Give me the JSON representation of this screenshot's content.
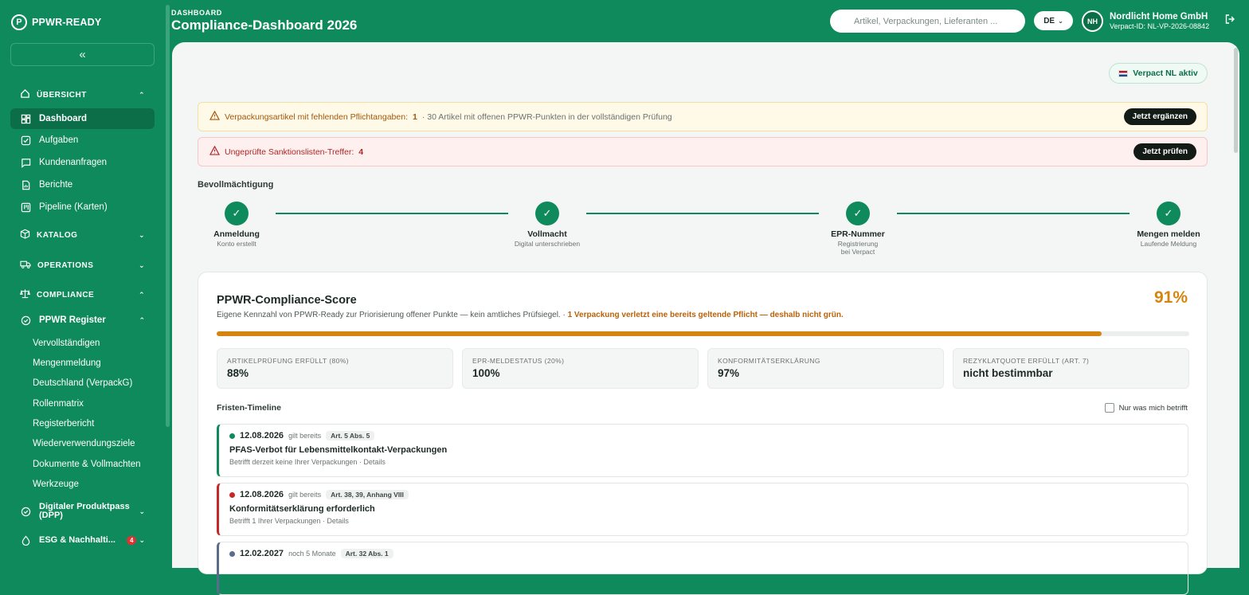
{
  "app": {
    "name": "PPWR-READY",
    "collapse": "«"
  },
  "sidebar": {
    "sections": [
      {
        "label": "ÜBERSICHT",
        "chev": "⌃"
      },
      {
        "label": "KATALOG",
        "chev": "⌄"
      },
      {
        "label": "OPERATIONS",
        "chev": "⌄"
      },
      {
        "label": "COMPLIANCE",
        "chev": "⌃"
      }
    ],
    "items": [
      {
        "label": "Dashboard"
      },
      {
        "label": "Aufgaben"
      },
      {
        "label": "Kundenanfragen"
      },
      {
        "label": "Berichte"
      },
      {
        "label": "Pipeline (Karten)"
      }
    ],
    "register": {
      "label": "PPWR Register",
      "chev": "⌃"
    },
    "subitems": [
      "Vervollständigen",
      "Mengenmeldung",
      "Deutschland (VerpackG)",
      "Rollenmatrix",
      "Registerbericht",
      "Wiederverwendungsziele",
      "Dokumente & Vollmachten",
      "Werkzeuge"
    ],
    "dpp": {
      "label1": "Digitaler Produktpass",
      "label2": "(DPP)",
      "chev": "⌄"
    },
    "esg": {
      "label": "ESG & Nachhalti...",
      "badge": "4",
      "chev": "⌄"
    }
  },
  "header": {
    "crumb": "DASHBOARD",
    "title": "Compliance-Dashboard 2026",
    "search_placeholder": "Artikel, Verpackungen, Lieferanten ...",
    "lang": "DE",
    "avatar": "NH",
    "org_name": "Nordlicht Home GmbH",
    "org_id": "Verpact-ID: NL-VP-2026-08842"
  },
  "verpact_badge": "Verpact NL aktiv",
  "alerts": {
    "warn": {
      "text": "Verpackungsartikel mit fehlenden Pflichtangaben:",
      "num": "1",
      "muted": "· 30 Artikel mit offenen PPWR-Punkten in der vollständigen Prüfung",
      "btn": "Jetzt ergänzen"
    },
    "err": {
      "text": "Ungeprüfte Sanktionslisten-Treffer:",
      "num": "4",
      "btn": "Jetzt prüfen"
    }
  },
  "bevollmaechtigung": {
    "title": "Bevollmächtigung",
    "steps": [
      {
        "label": "Anmeldung",
        "sub": "Konto erstellt"
      },
      {
        "label": "Vollmacht",
        "sub": "Digital unterschrieben"
      },
      {
        "label": "EPR-Nummer",
        "sub": "Registrierung bei Verpact"
      },
      {
        "label": "Mengen melden",
        "sub": "Laufende Meldung"
      }
    ]
  },
  "score": {
    "title": "PPWR-Compliance-Score",
    "pct": "91%",
    "progress": 0.91,
    "desc": "Eigene Kennzahl von PPWR-Ready zur Priorisierung offener Punkte — kein amtliches Prüfsiegel. ·",
    "desc_hl": "1 Verpackung verletzt eine bereits geltende Pflicht — deshalb nicht grün.",
    "kpis": [
      {
        "label": "ARTIKELPRÜFUNG ERFÜLLT (80%)",
        "value": "88%"
      },
      {
        "label": "EPR-MELDESTATUS (20%)",
        "value": "100%"
      },
      {
        "label": "KONFORMITÄTSERKLÄRUNG",
        "value": "97%"
      },
      {
        "label": "REZYKLATQUOTE ERFÜLLT (ART. 7)",
        "value": "nicht bestimmbar"
      }
    ]
  },
  "fristen": {
    "title": "Fristen-Timeline",
    "filter_label": "Nur was mich betrifft",
    "items": [
      {
        "date": "12.08.2026",
        "status": "gilt bereits",
        "tag": "Art. 5 Abs. 5",
        "title": "PFAS-Verbot für Lebensmittelkontakt-Verpackungen",
        "sub": "Betrifft derzeit keine Ihrer Verpackungen · Details",
        "color": "#0e8a5c"
      },
      {
        "date": "12.08.2026",
        "status": "gilt bereits",
        "tag": "Art. 38, 39, Anhang VIII",
        "title": "Konformitätserklärung erforderlich",
        "sub": "Betrifft 1 Ihrer Verpackungen · Details",
        "color": "#c62828"
      },
      {
        "date": "12.02.2027",
        "status": "noch 5 Monate",
        "tag": "Art. 32 Abs. 1",
        "title": "",
        "sub": "",
        "color": "#5b6b8a"
      }
    ]
  },
  "colors": {
    "brand": "#0e8a5c",
    "accent": "#d4850f"
  }
}
